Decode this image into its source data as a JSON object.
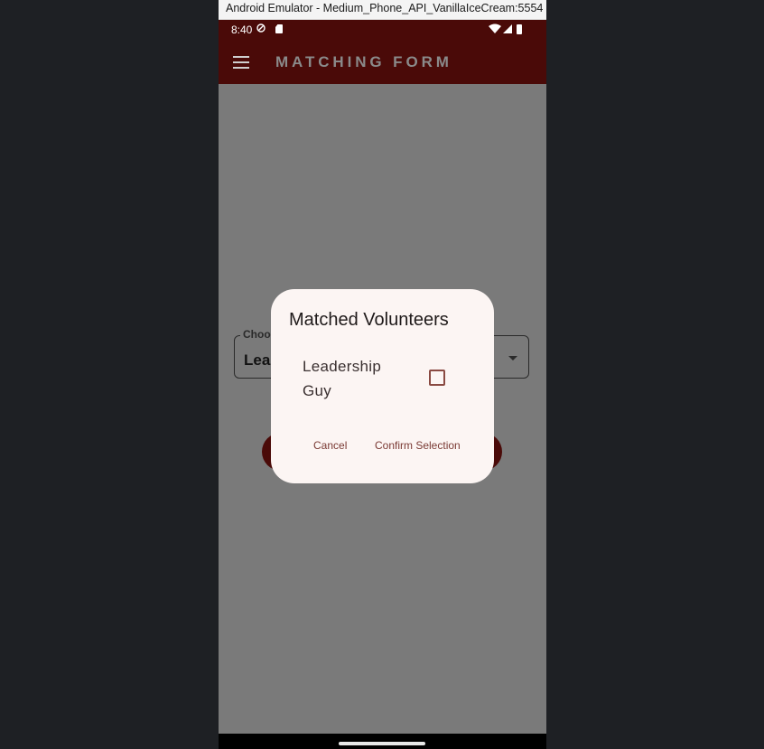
{
  "window": {
    "title": "Android Emulator - Medium_Phone_API_VanillaIceCream:5554"
  },
  "status_bar": {
    "time": "8:40"
  },
  "app_bar": {
    "title": "MATCHING FORM"
  },
  "form": {
    "select_label": "Choo",
    "select_value": "Lea"
  },
  "dialog": {
    "title": "Matched Volunteers",
    "items": [
      {
        "label": "Leadership Guy",
        "checked": false
      }
    ],
    "cancel_label": "Cancel",
    "confirm_label": "Confirm Selection"
  },
  "colors": {
    "app_bar": "#4a0a08",
    "scrim": "#7a7a7a",
    "dialog_bg": "#fcf5f3",
    "accent_text": "#7a3a34"
  }
}
